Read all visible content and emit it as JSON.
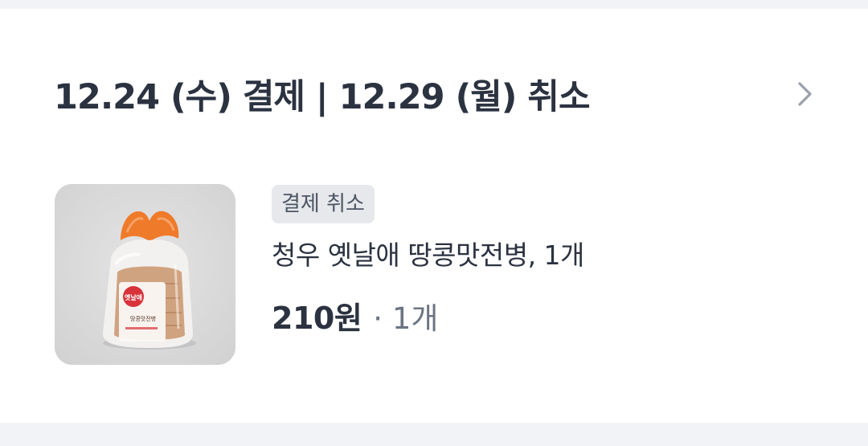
{
  "order": {
    "header_title": "12.24 (수) 결제 | 12.29 (월) 취소",
    "status_badge": "결제 취소",
    "product_name": "청우 옛날애 땅콩맛전병, 1개",
    "price": "210원",
    "quantity": "· 1개",
    "thumbnail_label": "옛날애 땅콩맛전병"
  },
  "icons": {
    "chevron": "chevron-right-icon"
  },
  "colors": {
    "page_background": "#f2f3f6",
    "card_background": "#ffffff",
    "title_text": "#2b3240",
    "badge_background": "#e6e8ec",
    "badge_text": "#4d5563",
    "quantity_text": "#6b7482",
    "chevron": "#9aa1ad"
  }
}
